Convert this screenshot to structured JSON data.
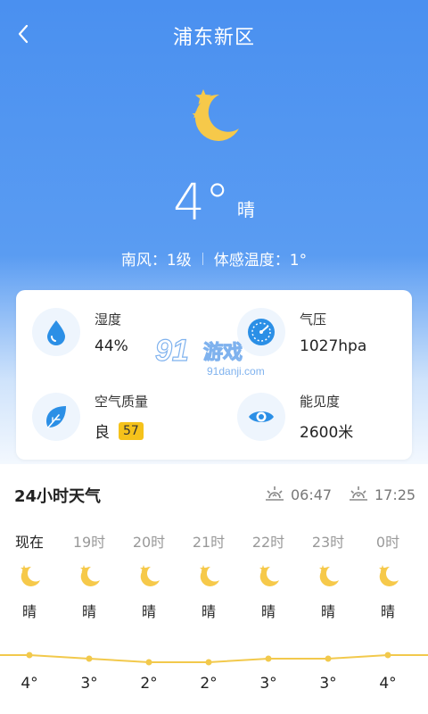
{
  "header": {
    "back_icon": "chevron-left-icon",
    "title": "浦东新区"
  },
  "current": {
    "icon": "moon-stars-icon",
    "temperature": "4°",
    "condition": "晴",
    "wind": "南风：1级",
    "feels_like": "体感温度：1°"
  },
  "details": {
    "humidity": {
      "icon": "water-drop-icon",
      "label": "湿度",
      "value": "44%"
    },
    "pressure": {
      "icon": "gauge-icon",
      "label": "气压",
      "value": "1027hpa"
    },
    "air_quality": {
      "icon": "leaf-icon",
      "label": "空气质量",
      "value": "良",
      "aqi": "57"
    },
    "visibility": {
      "icon": "eye-icon",
      "label": "能见度",
      "value": "2600米"
    }
  },
  "watermark": {
    "line1": "91游戏",
    "line2": "91danji.com"
  },
  "hourly": {
    "title": "24小时天气",
    "sunrise": "06:47",
    "sunset": "17:25",
    "items": [
      {
        "time": "现在",
        "condition": "晴",
        "temp": "4°",
        "value": 4
      },
      {
        "time": "19时",
        "condition": "晴",
        "temp": "3°",
        "value": 3
      },
      {
        "time": "20时",
        "condition": "晴",
        "temp": "2°",
        "value": 2
      },
      {
        "time": "21时",
        "condition": "晴",
        "temp": "2°",
        "value": 2
      },
      {
        "time": "22时",
        "condition": "晴",
        "temp": "3°",
        "value": 3
      },
      {
        "time": "23时",
        "condition": "晴",
        "temp": "3°",
        "value": 3
      },
      {
        "time": "0时",
        "condition": "晴",
        "temp": "4°",
        "value": 4
      }
    ]
  },
  "colors": {
    "header_blue": "#4a90f0",
    "accent_blue": "#2b8fe6",
    "aqi_yellow": "#f5c21b",
    "moon_yellow": "#f6c94a",
    "temp_line": "#f2c94c"
  }
}
